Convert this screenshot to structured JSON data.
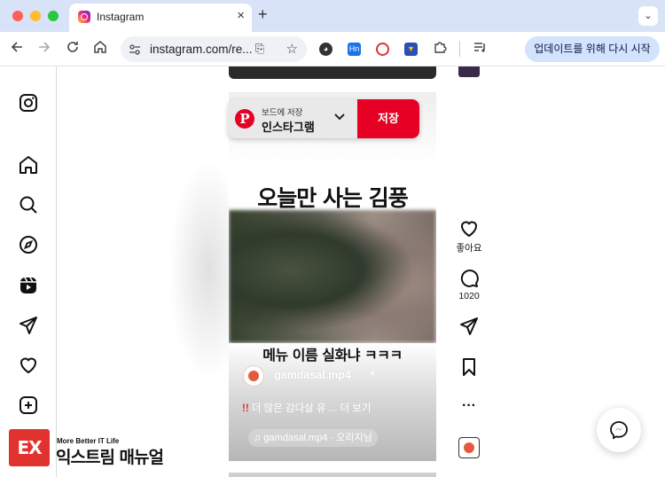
{
  "browser": {
    "tab_title": "Instagram",
    "tab_close": "×",
    "new_tab": "+",
    "tab_menu": "⌄",
    "url": "instagram.com/re...",
    "update_button": "업데이트를 위해 다시 시작",
    "ext_hn": "Hn"
  },
  "pinterest": {
    "logo": "P",
    "save_to_board_label": "보드에 저장",
    "board_name": "인스타그램",
    "save_button": "저장"
  },
  "reel": {
    "headline": "오늘만 사는 김풍",
    "subtitle": "메뉴 이름 실화냐 ㅋㅋㅋ",
    "username": "gamdasal.mp4",
    "username_suffix": "•",
    "caption_mark": "!!",
    "caption": " 더 많은 감다살 유 ... 더 보기",
    "audio": "♫ gamdasal.mp4 · 오리지님"
  },
  "actions": {
    "like_label": "좋아요",
    "comment_count": "1020",
    "more": "···"
  },
  "watermark": {
    "tagline": "More Better IT Life",
    "name": "익스트림 매뉴얼",
    "logo_text": "EX"
  },
  "colors": {
    "pinterest_red": "#e60023",
    "accent_chrome": "#d3e2fd"
  }
}
